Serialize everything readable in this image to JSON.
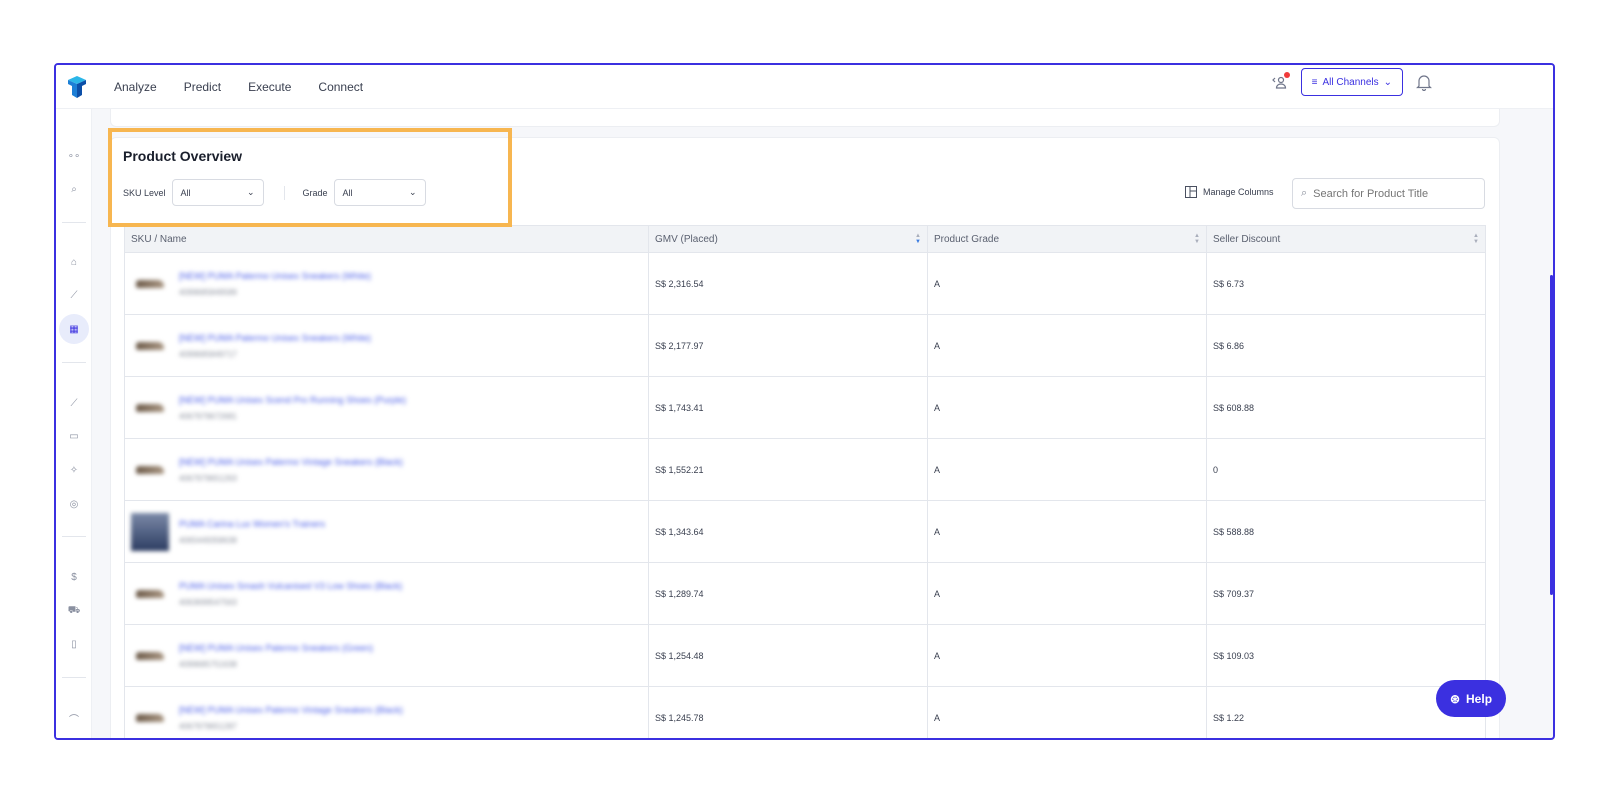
{
  "nav": {
    "items": [
      "Analyze",
      "Predict",
      "Execute",
      "Connect"
    ]
  },
  "header": {
    "channels_label": "All Channels"
  },
  "overview": {
    "title": "Product Overview",
    "sku_level_label": "SKU Level",
    "sku_level_value": "All",
    "grade_label": "Grade",
    "grade_value": "All",
    "manage_columns": "Manage Columns",
    "search_placeholder": "Search for Product Title"
  },
  "table": {
    "columns": [
      "SKU / Name",
      "GMV (Placed)",
      "Product Grade",
      "Seller Discount"
    ],
    "rows": [
      {
        "name": "[NEW] PUMA Palermo Unisex Sneakers (White)",
        "sku": "4099685849589",
        "gmv": "S$ 2,316.54",
        "grade": "A",
        "discount": "S$ 6.73"
      },
      {
        "name": "[NEW] PUMA Palermo Unisex Sneakers (White)",
        "sku": "4099685849717",
        "gmv": "S$ 2,177.97",
        "grade": "A",
        "discount": "S$ 6.86"
      },
      {
        "name": "[NEW] PUMA Unisex Scend Pro Running Shoes (Purple)",
        "sku": "4067979672681",
        "gmv": "S$ 1,743.41",
        "grade": "A",
        "discount": "S$ 608.88"
      },
      {
        "name": "[NEW] PUMA Unisex Palermo Vintage Sneakers (Black)",
        "sku": "4067979651263",
        "gmv": "S$ 1,552.21",
        "grade": "A",
        "discount": "0"
      },
      {
        "name": "PUMA Carina Lux Women's Trainers",
        "sku": "4065449358638",
        "gmv": "S$ 1,343.64",
        "grade": "A",
        "discount": "S$ 588.88"
      },
      {
        "name": "PUMA Unisex Smash Vulcanised V3 Low Shoes (Black)",
        "sku": "4063699547563",
        "gmv": "S$ 1,289.74",
        "grade": "A",
        "discount": "S$ 709.37"
      },
      {
        "name": "[NEW] PUMA Unisex Palermo Sneakers (Green)",
        "sku": "4099685751638",
        "gmv": "S$ 1,254.48",
        "grade": "A",
        "discount": "S$ 109.03"
      },
      {
        "name": "[NEW] PUMA Unisex Palermo Vintage Sneakers (Black)",
        "sku": "4067979651287",
        "gmv": "S$ 1,245.78",
        "grade": "A",
        "discount": "S$ 1.22"
      }
    ]
  },
  "help": {
    "label": "Help"
  }
}
